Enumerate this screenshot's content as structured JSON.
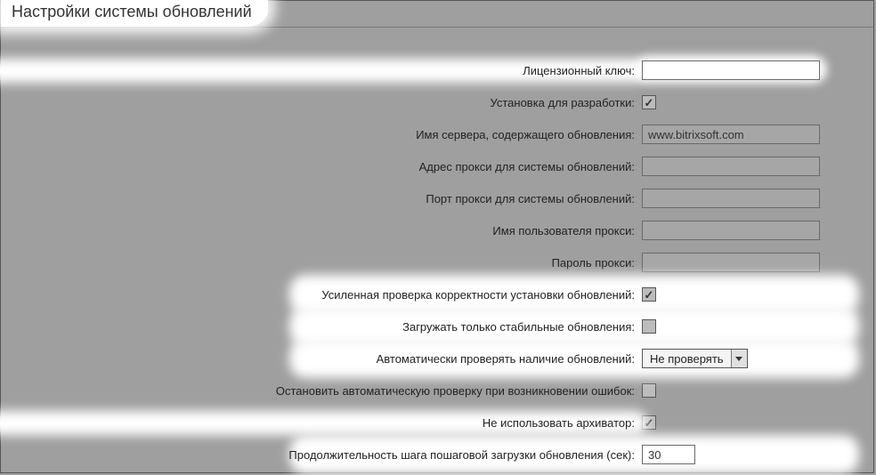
{
  "title": "Настройки системы обновлений",
  "fields": {
    "license_key": {
      "label": "Лицензионный ключ:",
      "value": ""
    },
    "dev_install": {
      "label": "Установка для разработки:",
      "checked": true
    },
    "update_server": {
      "label": "Имя сервера, содержащего обновления:",
      "value": "www.bitrixsoft.com"
    },
    "proxy_addr": {
      "label": "Адрес прокси для системы обновлений:",
      "value": ""
    },
    "proxy_port": {
      "label": "Порт прокси для системы обновлений:",
      "value": ""
    },
    "proxy_user": {
      "label": "Имя пользователя прокси:",
      "value": ""
    },
    "proxy_pass": {
      "label": "Пароль прокси:",
      "value": ""
    },
    "strong_check": {
      "label": "Усиленная проверка корректности установки обновлений:",
      "checked": true
    },
    "stable_only": {
      "label": "Загружать только стабильные обновления:",
      "checked": false
    },
    "auto_check": {
      "label": "Автоматически проверять наличие обновлений:",
      "selected": "Не проверять"
    },
    "stop_on_err": {
      "label": "Остановить автоматическую проверку при возникновении ошибок:",
      "checked": false
    },
    "no_archiver": {
      "label": "Не использовать архиватор:",
      "checked": true
    },
    "step_duration": {
      "label": "Продолжительность шага пошаговой загрузки обновления (сек):",
      "value": "30"
    }
  }
}
